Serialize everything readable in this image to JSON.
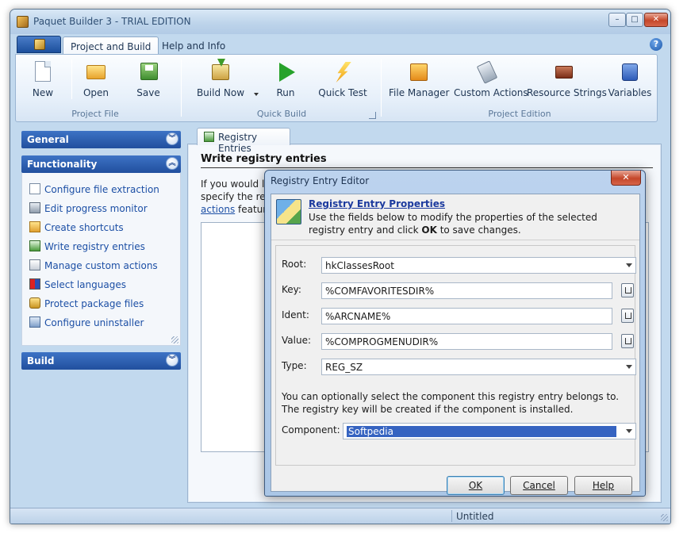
{
  "window": {
    "title": "Paquet Builder 3 - TRIAL EDITION",
    "controls": {
      "minimize": "–",
      "maximize": "□",
      "close": "✕"
    }
  },
  "ribbon": {
    "tabs": [
      {
        "label": "Project and Build",
        "active": true
      },
      {
        "label": "Help and Info",
        "active": false
      }
    ],
    "help_glyph": "?",
    "groups": [
      {
        "label": "Project File",
        "buttons": [
          {
            "label": "New",
            "icon": "new-document-icon"
          },
          {
            "label": "Open",
            "icon": "open-folder-icon"
          },
          {
            "label": "Save",
            "icon": "save-icon"
          }
        ]
      },
      {
        "label": "Quick Build",
        "buttons": [
          {
            "label": "Build Now",
            "icon": "build-icon"
          },
          {
            "label": "Run",
            "icon": "run-icon"
          },
          {
            "label": "Quick Test",
            "icon": "lightning-icon"
          }
        ]
      },
      {
        "label": "Project Edition",
        "buttons": [
          {
            "label": "File Manager",
            "icon": "file-manager-icon"
          },
          {
            "label": "Custom Actions",
            "icon": "custom-actions-icon"
          },
          {
            "label": "Resource Strings",
            "icon": "resource-strings-icon"
          },
          {
            "label": "Variables",
            "icon": "variables-icon"
          }
        ]
      }
    ]
  },
  "taskpane": {
    "sections": [
      {
        "label": "General",
        "chevron": "︾"
      },
      {
        "label": "Functionality",
        "chevron": "︽",
        "items": [
          "Configure file extraction",
          "Edit progress monitor",
          "Create shortcuts",
          "Write registry entries",
          "Manage custom actions",
          "Select languages",
          "Protect package files",
          "Configure uninstaller"
        ]
      },
      {
        "label": "Build",
        "chevron": "︾"
      }
    ]
  },
  "document": {
    "tab_label": "Registry Entries",
    "heading": "Write registry entries",
    "text_line1": "If you would lik",
    "text_line2": "specify the regi",
    "link": "actions",
    "text_line3_rest": " feature."
  },
  "status": {
    "text": "Untitled"
  },
  "dialog": {
    "title": "Registry Entry Editor",
    "close": "✕",
    "header_link": "Registry Entry Properties",
    "header_desc_1": "Use the fields below to modify the properties of the selected registry entry and click ",
    "header_desc_bold": "OK",
    "header_desc_2": " to save changes.",
    "fields": {
      "root_label": "Root:",
      "root_value": "hkClassesRoot",
      "key_label": "Key:",
      "key_value": "%COMFAVORITESDIR%",
      "ident_label": "Ident:",
      "ident_value": "%ARCNAME%",
      "value_label": "Value:",
      "value_value": "%COMPROGMENUDIR%",
      "type_label": "Type:",
      "type_value": "REG_SZ"
    },
    "component_note": "You can optionally select the component this registry entry belongs to. The registry key will be created if the component is installed.",
    "component_label": "Component:",
    "component_value": "Softpedia",
    "buttons": {
      "ok": "OK",
      "cancel": "Cancel",
      "help": "Help"
    }
  }
}
